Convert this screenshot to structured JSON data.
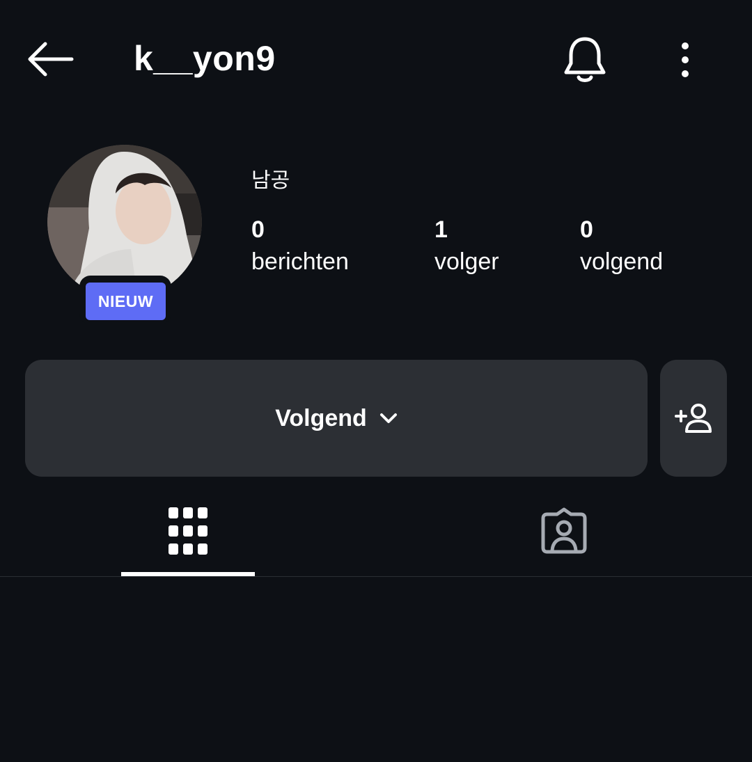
{
  "header": {
    "username": "k__yon9",
    "back_icon": "arrow-left-icon",
    "bell_icon": "bell-icon",
    "more_icon": "more-vertical-icon"
  },
  "profile": {
    "display_name": "남공",
    "new_badge": "NIEUW",
    "stats": [
      {
        "value": "0",
        "label": "berichten"
      },
      {
        "value": "1",
        "label": "volger"
      },
      {
        "value": "0",
        "label": "volgend"
      }
    ]
  },
  "actions": {
    "follow_label": "Volgend",
    "follow_icon": "chevron-down-icon",
    "add_icon": "add-person-icon"
  },
  "tabs": [
    {
      "icon": "grid-icon",
      "active": true
    },
    {
      "icon": "tagged-icon",
      "active": false
    }
  ],
  "colors": {
    "background": "#0d1015",
    "button": "#2c2f34",
    "badge": "#5e6cf5",
    "text": "#ffffff",
    "inactive_icon": "#a6abb3"
  }
}
